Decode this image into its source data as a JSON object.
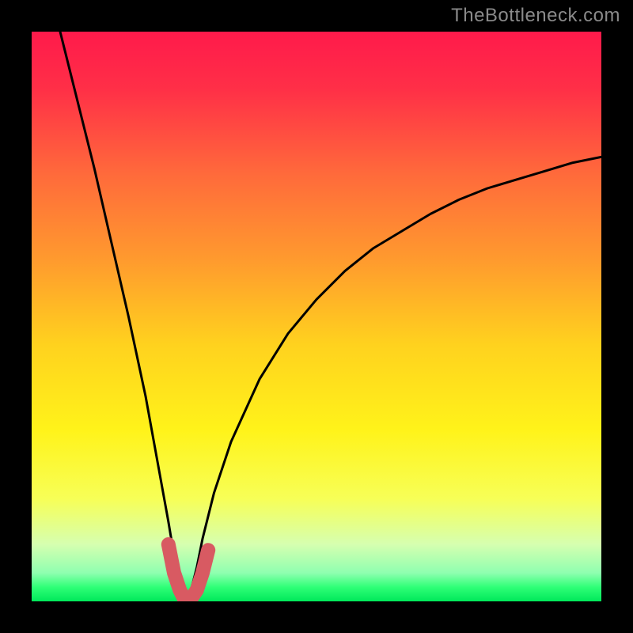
{
  "watermark": "TheBottleneck.com",
  "gradient": {
    "stops": [
      {
        "offset": 0.0,
        "color": "#ff1a4b"
      },
      {
        "offset": 0.1,
        "color": "#ff2f47"
      },
      {
        "offset": 0.25,
        "color": "#ff6a3b"
      },
      {
        "offset": 0.4,
        "color": "#ff9a2e"
      },
      {
        "offset": 0.55,
        "color": "#ffd21e"
      },
      {
        "offset": 0.7,
        "color": "#fff31a"
      },
      {
        "offset": 0.82,
        "color": "#f7ff57"
      },
      {
        "offset": 0.9,
        "color": "#d6ffb0"
      },
      {
        "offset": 0.95,
        "color": "#8fffb0"
      },
      {
        "offset": 0.975,
        "color": "#2fff77"
      },
      {
        "offset": 1.0,
        "color": "#00e85a"
      }
    ]
  },
  "chart_data": {
    "type": "line",
    "title": "",
    "xlabel": "",
    "ylabel": "",
    "xlim": [
      0,
      100
    ],
    "ylim": [
      0,
      100
    ],
    "series": [
      {
        "name": "bottleneck-curve",
        "x_min_at": 27,
        "x": [
          5,
          8,
          11,
          14,
          17,
          20,
          22,
          24,
          25,
          26,
          27,
          28,
          29,
          30,
          32,
          35,
          40,
          45,
          50,
          55,
          60,
          65,
          70,
          75,
          80,
          85,
          90,
          95,
          100
        ],
        "values": [
          100,
          88,
          76,
          63,
          50,
          36,
          25,
          14,
          8,
          3,
          0,
          2,
          6,
          11,
          19,
          28,
          39,
          47,
          53,
          58,
          62,
          65,
          68,
          70.5,
          72.5,
          74,
          75.5,
          77,
          78
        ]
      },
      {
        "name": "highlight-segment",
        "x": [
          24,
          25,
          26,
          27,
          28,
          29,
          30,
          31
        ],
        "values": [
          10,
          5,
          2,
          0,
          0.5,
          2,
          5,
          9
        ]
      }
    ]
  }
}
